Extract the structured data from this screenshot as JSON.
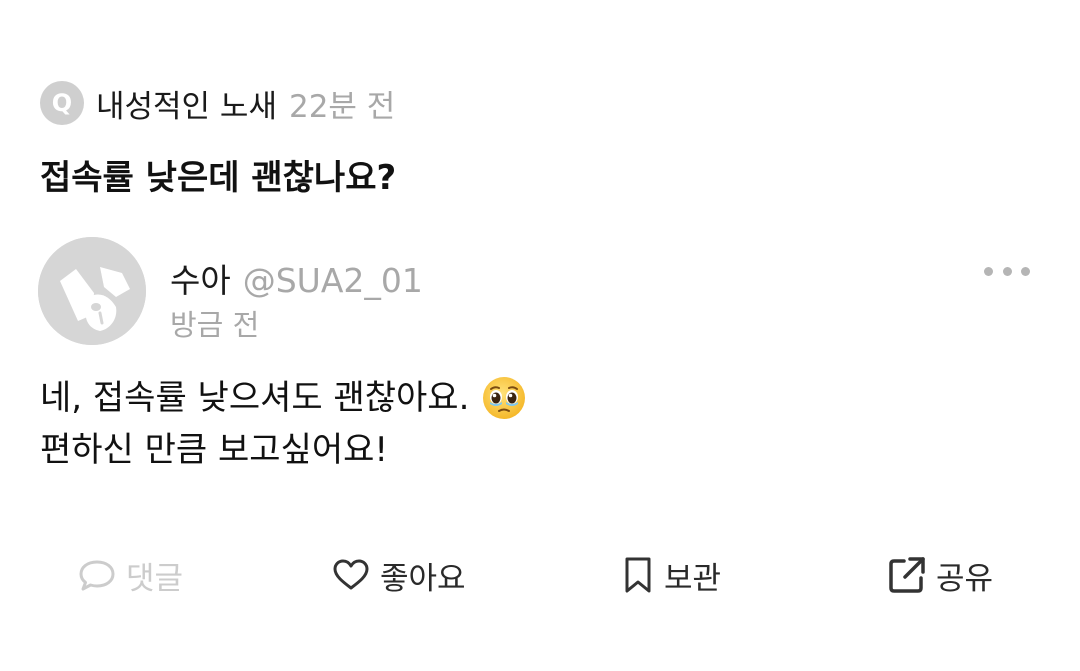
{
  "question": {
    "badge": "Q",
    "author": "내성적인 노새",
    "time": "22분 전",
    "title": "접속률 낮은데 괜찮나요?"
  },
  "reply": {
    "name": "수아",
    "handle": "@SUA2_01",
    "time": "방금 전",
    "lines": [
      "네, 접속률 낮으셔도 괜찮아요.",
      "편하신 만큼 보고싶어요!"
    ],
    "emoji": "pleading-face-icon"
  },
  "actions": {
    "comment": "댓글",
    "like": "좋아요",
    "bookmark": "보관",
    "share": "공유"
  },
  "colors": {
    "primary_text": "#111111",
    "muted_text": "#a8a8a8",
    "disabled": "#cccccc",
    "avatar_bg": "#d6d6d6"
  }
}
